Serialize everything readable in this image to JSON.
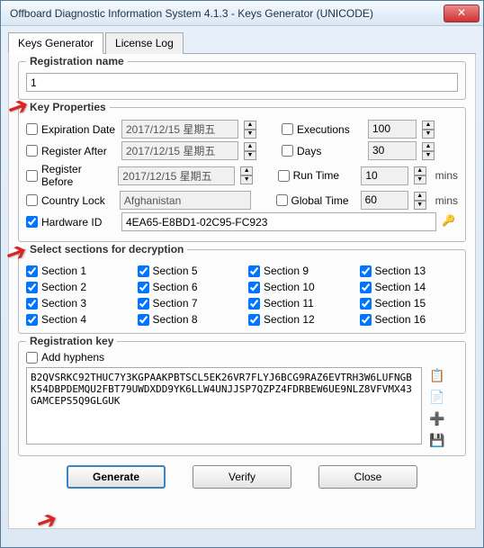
{
  "window": {
    "title": "Offboard Diagnostic Information System 4.1.3 - Keys Generator (UNICODE)"
  },
  "tabs": {
    "keys": "Keys Generator",
    "log": "License Log"
  },
  "reg_name": {
    "legend": "Registration name",
    "value": "1"
  },
  "kp": {
    "legend": "Key Properties",
    "exp_date": "Expiration Date",
    "exp_date_v": "2017/12/15 星期五",
    "reg_after": "Register After",
    "reg_after_v": "2017/12/15 星期五",
    "reg_before": "Register Before",
    "reg_before_v": "2017/12/15 星期五",
    "country": "Country Lock",
    "country_v": "Afghanistan",
    "hwid": "Hardware ID",
    "hwid_v": "4EA65-E8BD1-02C95-FC923",
    "exec": "Executions",
    "exec_v": "100",
    "days": "Days",
    "days_v": "30",
    "run": "Run Time",
    "run_v": "10",
    "global": "Global Time",
    "global_v": "60",
    "mins": "mins"
  },
  "sections": {
    "legend": "Select sections for decryption",
    "items": [
      "Section 1",
      "Section 2",
      "Section 3",
      "Section 4",
      "Section 5",
      "Section 6",
      "Section 7",
      "Section 8",
      "Section 9",
      "Section 10",
      "Section 11",
      "Section 12",
      "Section 13",
      "Section 14",
      "Section 15",
      "Section 16"
    ]
  },
  "regkey": {
    "legend": "Registration key",
    "hyphens": "Add hyphens",
    "value": "B2QVSRKC92THUC7Y3KGPAAKPBTSCL5EK26VR7FLYJ6BCG9RAZ6EVTRH3W6LUFNGBK54DBPDEMQU2FBT79UWDXDD9YK6LLW4UNJJSP7QZPZ4FDRBEW6UE9NLZ8VFVMX43GAMCEPS5Q9GLGUK"
  },
  "buttons": {
    "generate": "Generate",
    "verify": "Verify",
    "close": "Close"
  }
}
